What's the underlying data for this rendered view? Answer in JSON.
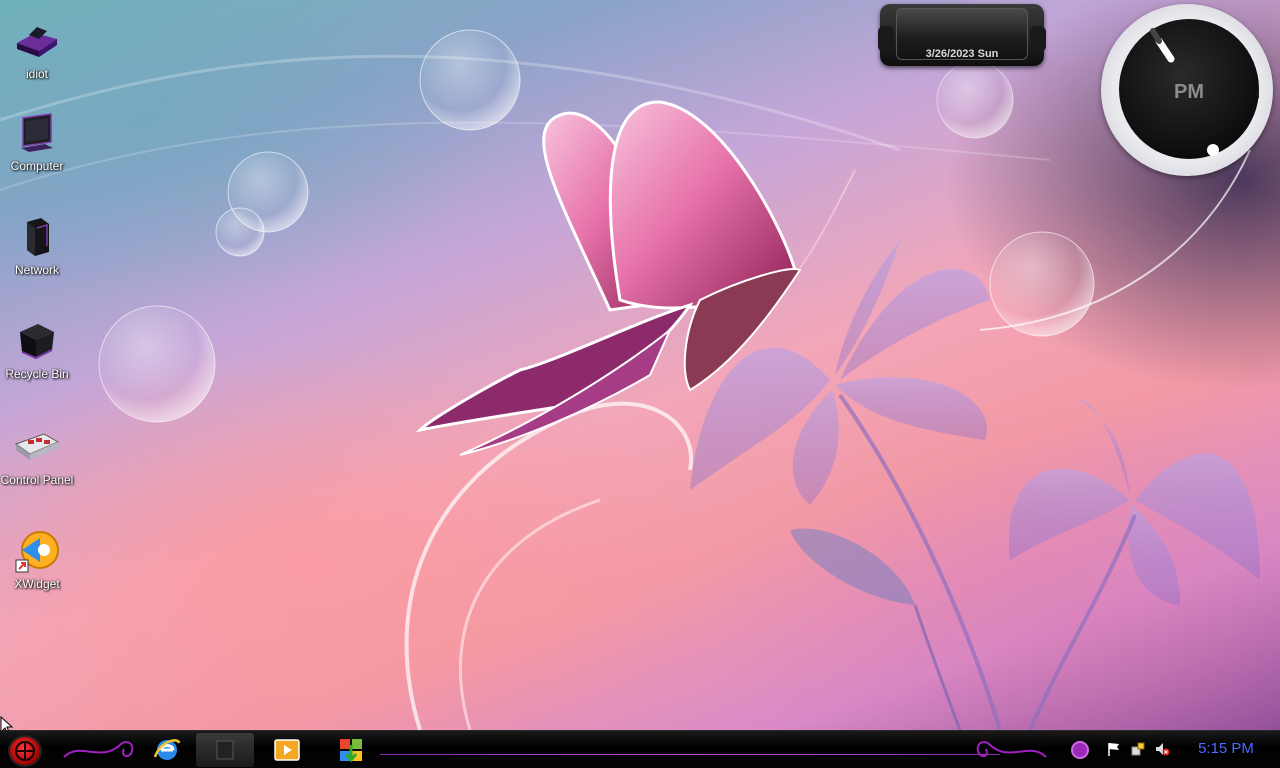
{
  "desktop": {
    "icons": [
      {
        "label": "idiot",
        "icon": "user-folder-icon"
      },
      {
        "label": "Computer",
        "icon": "computer-icon"
      },
      {
        "label": "Network",
        "icon": "network-icon"
      },
      {
        "label": "Recycle Bin",
        "icon": "recycle-bin-icon"
      },
      {
        "label": "Control Panel",
        "icon": "control-panel-icon"
      },
      {
        "label": "XWidget",
        "icon": "xwidget-icon"
      }
    ]
  },
  "widgets": {
    "date": {
      "text": "3/26/2023 Sun"
    },
    "clock": {
      "ampm": "PM"
    }
  },
  "taskbar": {
    "start_icon": "start-orb-icon",
    "apps": [
      {
        "name": "internet-explorer",
        "icon": "internet-explorer-icon"
      },
      {
        "name": "window-switcher",
        "icon": "window-icon"
      },
      {
        "name": "media-player",
        "icon": "media-player-icon"
      },
      {
        "name": "windows-update",
        "icon": "windows-update-icon"
      }
    ],
    "tray": {
      "icons": [
        "purple-app-icon",
        "action-center-flag-icon",
        "network-icon",
        "volume-muted-icon"
      ],
      "clock": "5:15 PM"
    }
  },
  "colors": {
    "taskbar": "#000000",
    "tray_clock": "#4a6cff",
    "accent": "#c24ad8"
  }
}
